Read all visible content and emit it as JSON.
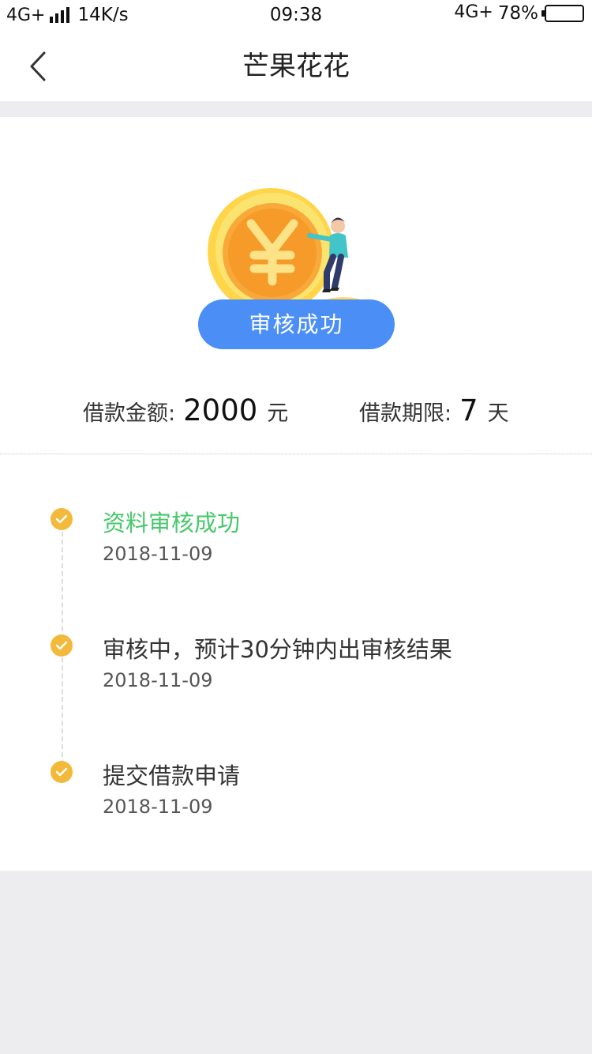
{
  "status_bar": {
    "network_left": "4G+",
    "speed": "14K/s",
    "time": "09:38",
    "network_right": "4G+",
    "battery_percent_text": "78%",
    "battery_level": 0.78
  },
  "nav": {
    "back_icon": "chevron-left-icon",
    "title": "芒果花花"
  },
  "hero": {
    "illustration": "coin-illustration",
    "status_label": "审核成功"
  },
  "loan_info": {
    "amount_label": "借款金额:",
    "amount_value": "2000",
    "amount_unit": "元",
    "term_label": "借款期限:",
    "term_value": "7",
    "term_unit": "天"
  },
  "timeline": {
    "items": [
      {
        "title": "资料审核成功",
        "date": "2018-11-09",
        "state": "success"
      },
      {
        "title": "审核中，预计30分钟内出审核结果",
        "date": "2018-11-09",
        "state": "done"
      },
      {
        "title": "提交借款申请",
        "date": "2018-11-09",
        "state": "done"
      }
    ]
  },
  "colors": {
    "accent_blue": "#4b8ff6",
    "success_green": "#47c86b",
    "dot_yellow": "#f3b93a",
    "page_bg": "#ededef"
  }
}
